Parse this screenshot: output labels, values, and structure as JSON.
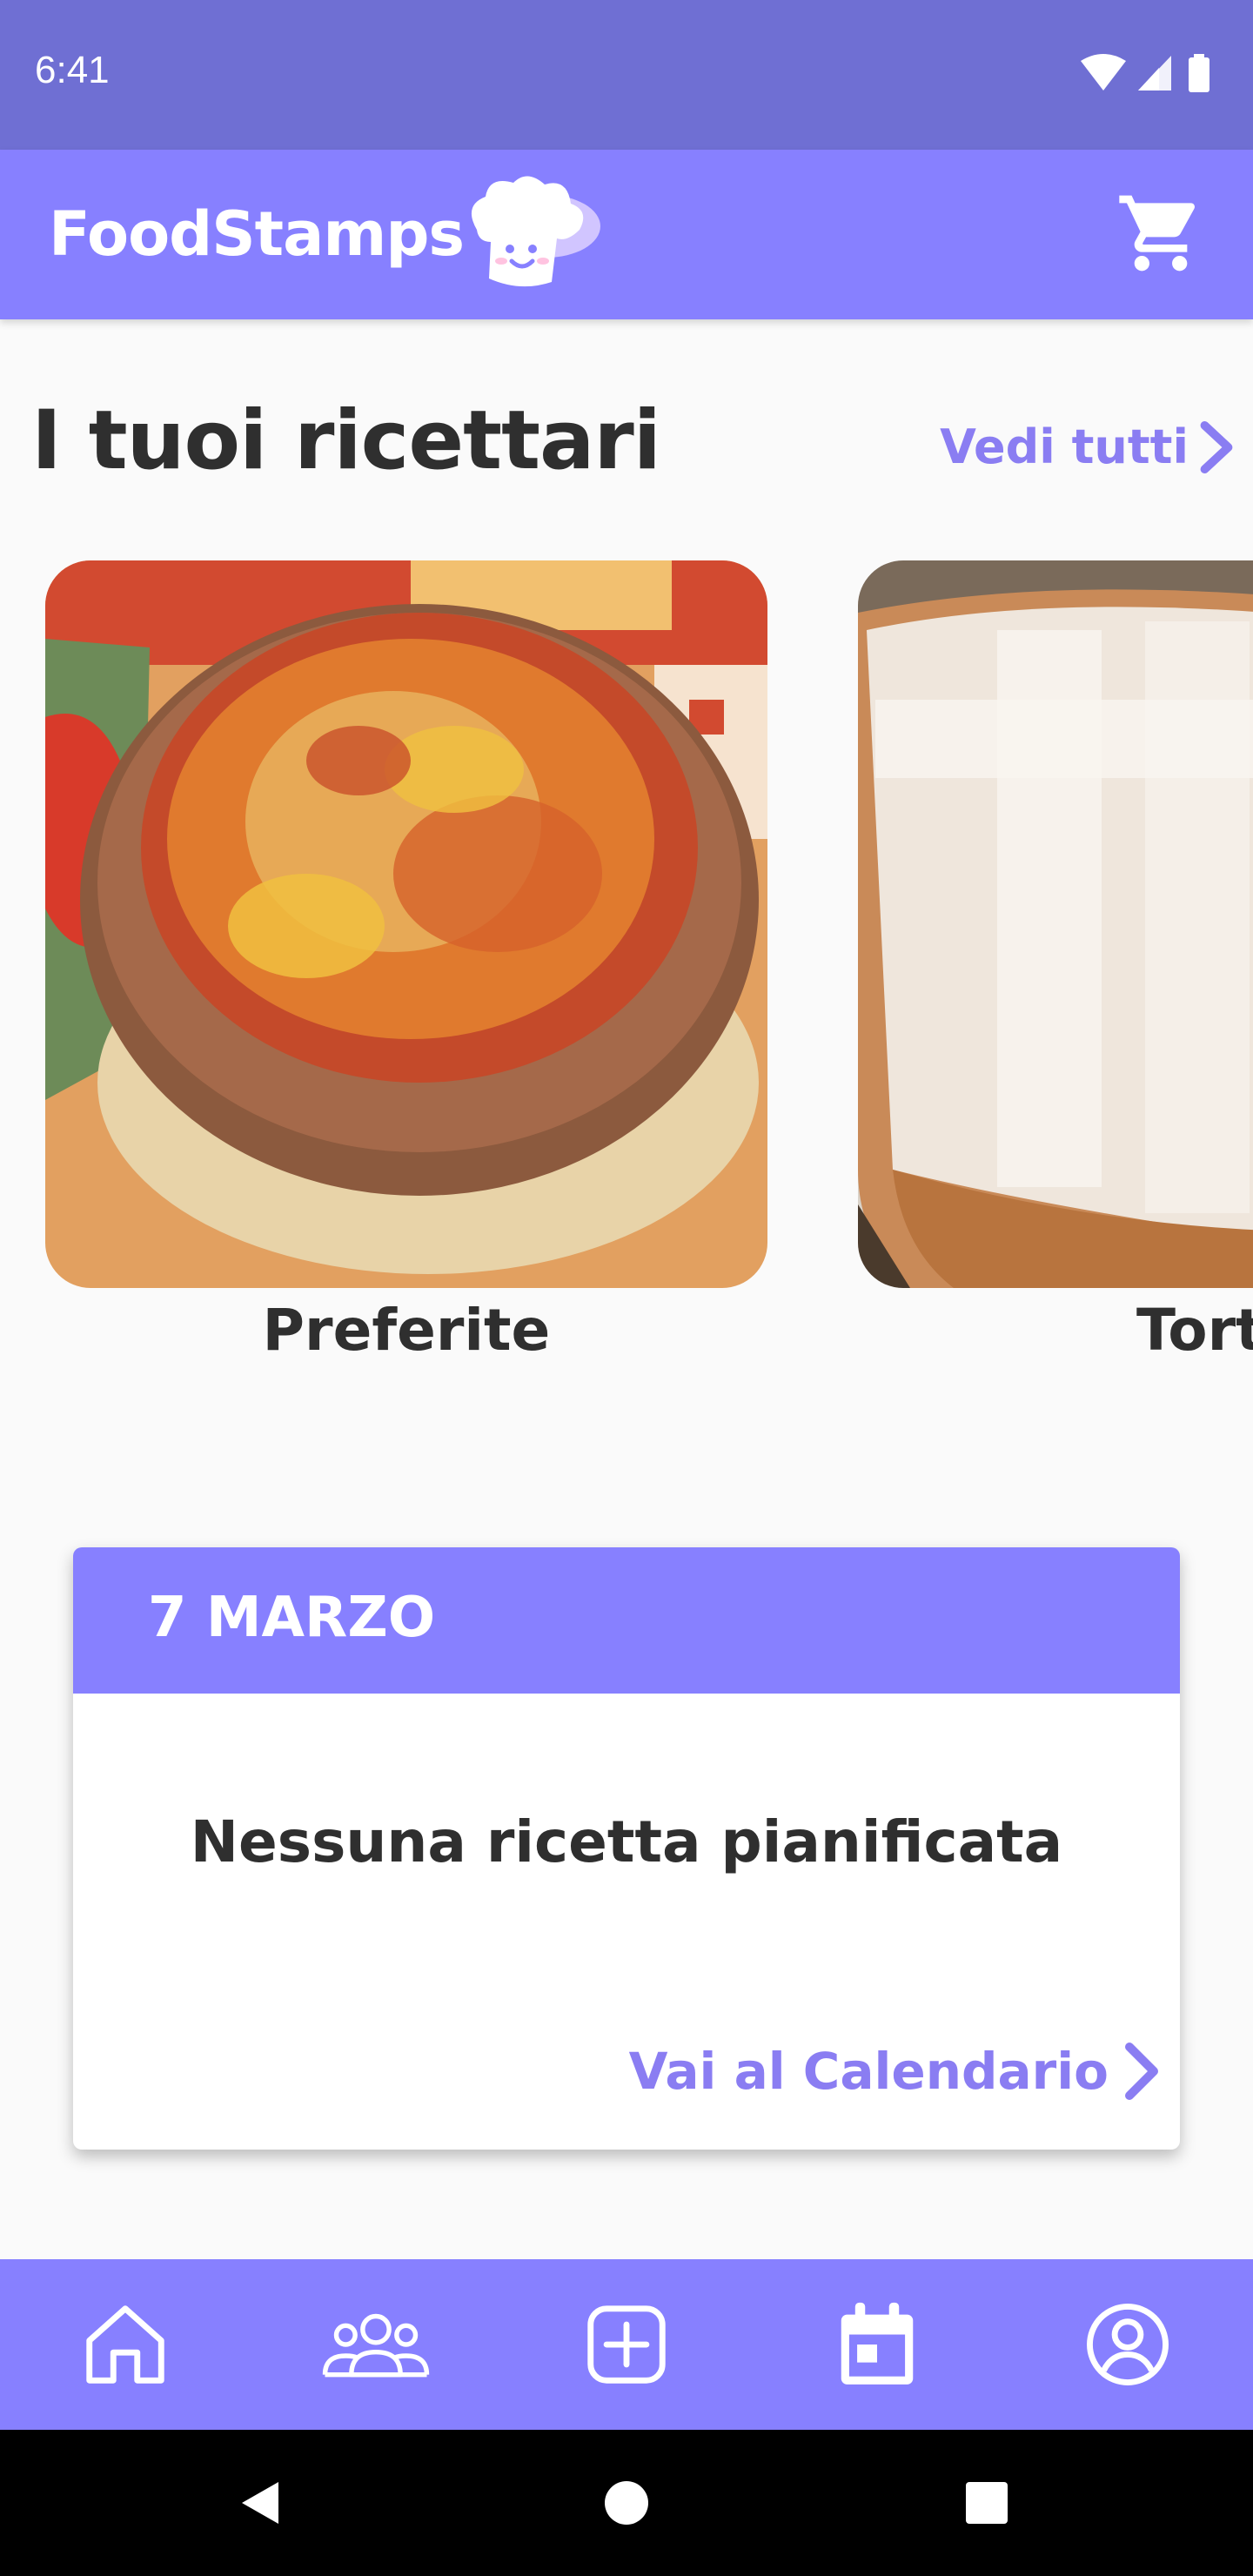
{
  "status_bar": {
    "time": "6:41",
    "icons": [
      "wifi-icon",
      "signal-icon",
      "battery-icon"
    ]
  },
  "app_bar": {
    "title": "FoodStamps",
    "logo": "chef-hat-logo",
    "cart_icon": "shopping-cart-icon"
  },
  "cookbooks": {
    "title": "I tuoi ricettari",
    "see_all": "Vedi tutti",
    "items": [
      {
        "label": "Preferite",
        "image": "baked-pasta-photo"
      },
      {
        "label": "Tort",
        "image": "tart-photo"
      }
    ]
  },
  "planner": {
    "date": "7 MARZO",
    "empty_message": "Nessuna ricetta pianificata",
    "link": "Vai al Calendario"
  },
  "bottom_nav": {
    "items": [
      "home-icon",
      "groups-icon",
      "add-icon",
      "calendar-icon",
      "profile-icon"
    ]
  },
  "system_nav": {
    "items": [
      "back-icon",
      "home-circle-icon",
      "recents-icon"
    ]
  },
  "colors": {
    "status_bar": "#6f6fd3",
    "accent": "#8780ff",
    "link": "#8a7df2",
    "background": "#fafafa"
  }
}
